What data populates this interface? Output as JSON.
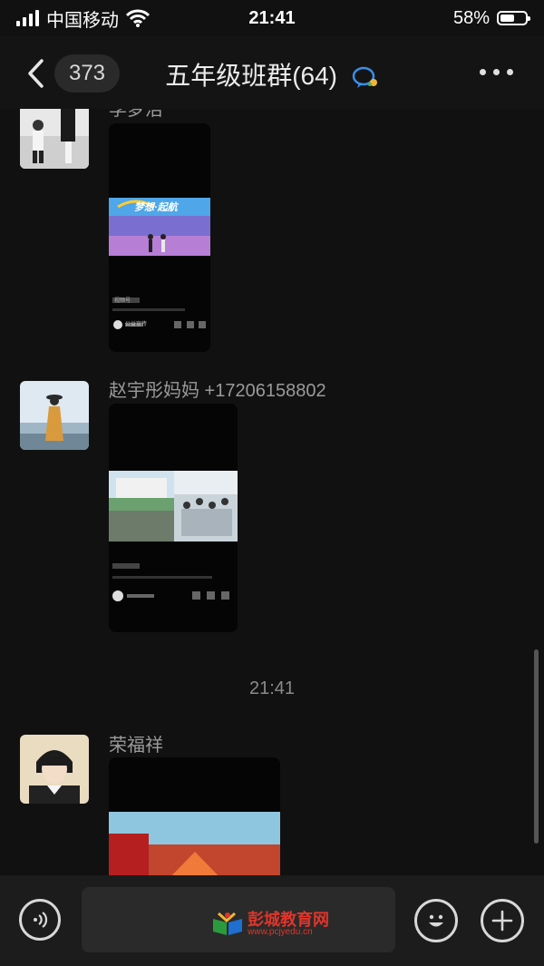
{
  "status": {
    "carrier": "中国移动",
    "time": "21:41",
    "battery": "58%",
    "battery_level": 0.58
  },
  "nav": {
    "unread_count": "373",
    "title": "五年级班群(64)"
  },
  "messages": [
    {
      "sender": "李梦洁",
      "type": "video",
      "banner_text": "梦想·起航",
      "channel_label": "视频号",
      "author": "公益宣传"
    },
    {
      "sender": "赵宇彤妈妈 +17206158802",
      "type": "video"
    },
    {
      "sender": "荣福祥",
      "type": "video"
    }
  ],
  "timestamp": "21:41",
  "watermark": {
    "name": "彭城教育网",
    "url": "www.pcjyedu.cn"
  },
  "colors": {
    "background": "#111111",
    "watermark": "#e0352b"
  }
}
